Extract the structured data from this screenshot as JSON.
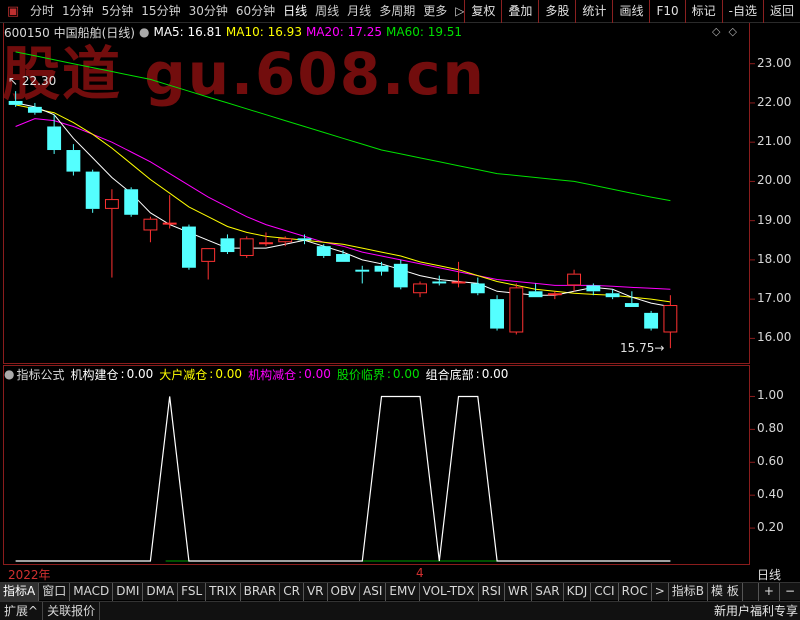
{
  "toolbar": {
    "icon": "menu-icon",
    "timeframes": [
      "分时",
      "1分钟",
      "5分钟",
      "15分钟",
      "30分钟",
      "60分钟",
      "日线",
      "周线",
      "月线",
      "多周期",
      "更多"
    ],
    "active": "日线",
    "more_arrow": "▷",
    "buttons": [
      "复权",
      "叠加",
      "多股",
      "统计",
      "画线",
      "F10",
      "标记",
      "-自选",
      "返回"
    ]
  },
  "stock": {
    "title": "600150 中国船舶(日线)"
  },
  "watermark": "股道 gu.608.cn",
  "ma": [
    {
      "label": "MA5: 16.81",
      "color": "#ffffff"
    },
    {
      "label": "MA10: 16.93",
      "color": "#ffff00"
    },
    {
      "label": "MA20: 17.25",
      "color": "#ff00ff"
    },
    {
      "label": "MA60: 19.51",
      "color": "#00e000"
    }
  ],
  "diamonds": "◇◇",
  "high_label": "22.30",
  "low_label": "15.75",
  "yaxis": [
    "23.00",
    "22.00",
    "21.00",
    "20.00",
    "19.00",
    "18.00",
    "17.00",
    "16.00"
  ],
  "chart_data": {
    "type": "candlestick",
    "ylim": [
      15.5,
      23.4
    ],
    "candles": [
      {
        "o": 22.05,
        "h": 22.3,
        "l": 21.9,
        "c": 21.95
      },
      {
        "o": 21.9,
        "h": 22.0,
        "l": 21.7,
        "c": 21.75
      },
      {
        "o": 21.4,
        "h": 21.7,
        "l": 20.7,
        "c": 20.8
      },
      {
        "o": 20.8,
        "h": 20.95,
        "l": 20.15,
        "c": 20.25
      },
      {
        "o": 20.25,
        "h": 20.3,
        "l": 19.2,
        "c": 19.3
      },
      {
        "o": 19.3,
        "h": 19.8,
        "l": 17.55,
        "c": 19.55
      },
      {
        "o": 19.8,
        "h": 19.85,
        "l": 19.1,
        "c": 19.15
      },
      {
        "o": 18.75,
        "h": 19.1,
        "l": 18.45,
        "c": 19.05
      },
      {
        "o": 18.95,
        "h": 19.65,
        "l": 18.8,
        "c": 18.95
      },
      {
        "o": 18.85,
        "h": 18.9,
        "l": 17.75,
        "c": 17.8
      },
      {
        "o": 17.95,
        "h": 18.3,
        "l": 17.5,
        "c": 18.3
      },
      {
        "o": 18.55,
        "h": 18.65,
        "l": 18.15,
        "c": 18.2
      },
      {
        "o": 18.1,
        "h": 18.6,
        "l": 18.05,
        "c": 18.55
      },
      {
        "o": 18.45,
        "h": 18.7,
        "l": 18.35,
        "c": 18.45
      },
      {
        "o": 18.45,
        "h": 18.6,
        "l": 18.35,
        "c": 18.55
      },
      {
        "o": 18.55,
        "h": 18.65,
        "l": 18.4,
        "c": 18.5
      },
      {
        "o": 18.35,
        "h": 18.4,
        "l": 18.05,
        "c": 18.1
      },
      {
        "o": 18.15,
        "h": 18.25,
        "l": 17.95,
        "c": 17.95
      },
      {
        "o": 17.75,
        "h": 17.85,
        "l": 17.4,
        "c": 17.7
      },
      {
        "o": 17.85,
        "h": 17.95,
        "l": 17.6,
        "c": 17.7
      },
      {
        "o": 17.9,
        "h": 18.0,
        "l": 17.25,
        "c": 17.3
      },
      {
        "o": 17.15,
        "h": 17.45,
        "l": 17.05,
        "c": 17.4
      },
      {
        "o": 17.45,
        "h": 17.6,
        "l": 17.35,
        "c": 17.4
      },
      {
        "o": 17.4,
        "h": 17.95,
        "l": 17.3,
        "c": 17.45
      },
      {
        "o": 17.4,
        "h": 17.55,
        "l": 17.1,
        "c": 17.15
      },
      {
        "o": 17.0,
        "h": 17.1,
        "l": 16.2,
        "c": 16.25
      },
      {
        "o": 16.15,
        "h": 17.4,
        "l": 16.1,
        "c": 17.3
      },
      {
        "o": 17.2,
        "h": 17.4,
        "l": 17.05,
        "c": 17.05
      },
      {
        "o": 17.1,
        "h": 17.2,
        "l": 17.0,
        "c": 17.15
      },
      {
        "o": 17.35,
        "h": 17.75,
        "l": 17.2,
        "c": 17.65
      },
      {
        "o": 17.35,
        "h": 17.4,
        "l": 17.1,
        "c": 17.2
      },
      {
        "o": 17.15,
        "h": 17.25,
        "l": 17.0,
        "c": 17.05
      },
      {
        "o": 16.9,
        "h": 17.2,
        "l": 16.8,
        "c": 16.8
      },
      {
        "o": 16.65,
        "h": 16.7,
        "l": 16.2,
        "c": 16.25
      },
      {
        "o": 16.15,
        "h": 17.1,
        "l": 15.75,
        "c": 16.85
      }
    ],
    "ma5": [
      22.0,
      21.9,
      21.7,
      21.1,
      20.6,
      20.1,
      19.7,
      19.2,
      18.9,
      18.7,
      18.5,
      18.3,
      18.3,
      18.3,
      18.4,
      18.5,
      18.35,
      18.2,
      18.0,
      17.9,
      17.75,
      17.6,
      17.5,
      17.45,
      17.4,
      17.2,
      17.15,
      17.1,
      17.1,
      17.2,
      17.3,
      17.25,
      17.05,
      16.9,
      16.81
    ],
    "ma10": [
      21.95,
      21.85,
      21.75,
      21.5,
      21.2,
      20.85,
      20.45,
      20.05,
      19.7,
      19.35,
      19.1,
      18.85,
      18.7,
      18.6,
      18.55,
      18.5,
      18.45,
      18.4,
      18.3,
      18.2,
      18.1,
      17.95,
      17.85,
      17.75,
      17.6,
      17.45,
      17.35,
      17.25,
      17.2,
      17.15,
      17.12,
      17.1,
      17.05,
      17.0,
      16.93
    ],
    "ma20": [
      21.4,
      21.6,
      21.55,
      21.4,
      21.2,
      21.0,
      20.75,
      20.5,
      20.2,
      19.9,
      19.6,
      19.35,
      19.1,
      18.9,
      18.75,
      18.6,
      18.45,
      18.35,
      18.2,
      18.1,
      18.0,
      17.9,
      17.8,
      17.7,
      17.6,
      17.5,
      17.45,
      17.4,
      17.35,
      17.35,
      17.35,
      17.33,
      17.3,
      17.28,
      17.25
    ],
    "ma60": [
      23.3,
      23.2,
      23.1,
      23.0,
      22.9,
      22.8,
      22.7,
      22.6,
      22.45,
      22.3,
      22.15,
      22.0,
      21.85,
      21.7,
      21.55,
      21.4,
      21.25,
      21.1,
      20.95,
      20.8,
      20.7,
      20.6,
      20.5,
      20.4,
      20.3,
      20.2,
      20.15,
      20.1,
      20.05,
      20.0,
      19.9,
      19.8,
      19.7,
      19.6,
      19.51
    ],
    "indicator": {
      "title": "指标公式",
      "ylim": [
        0,
        1.1
      ],
      "yaxis": [
        "1.00",
        "0.80",
        "0.60",
        "0.40",
        "0.20"
      ],
      "series": [
        {
          "name": "机构建仓",
          "value_label": "0.00",
          "color": "#ffffff",
          "values": [
            0,
            0,
            0,
            0,
            0,
            0,
            0,
            0,
            1,
            0,
            0,
            0,
            0,
            0,
            0,
            0,
            0,
            0,
            0,
            1,
            1,
            1,
            0,
            1,
            1,
            0,
            0,
            0,
            0,
            0,
            0,
            0,
            0,
            0,
            0
          ]
        },
        {
          "name": "大户减仓",
          "value_label": "0.00",
          "color": "#ffff00"
        },
        {
          "name": "机构减仓",
          "value_label": "0.00",
          "color": "#ff00ff"
        },
        {
          "name": "股价临界",
          "value_label": "0.00",
          "color": "#00e000"
        },
        {
          "name": "组合底部",
          "value_label": "0.00",
          "color": "#ffffff"
        }
      ]
    }
  },
  "dates": [
    {
      "label": "2022年",
      "index": 0
    },
    {
      "label": "4",
      "index": 21
    }
  ],
  "period_label": "日线",
  "tabs": [
    "指标A",
    "窗口",
    "MACD",
    "DMI",
    "DMA",
    "FSL",
    "TRIX",
    "BRAR",
    "CR",
    "VR",
    "OBV",
    "ASI",
    "EMV",
    "VOL-TDX",
    "RSI",
    "WR",
    "SAR",
    "KDJ",
    "CCI",
    "ROC",
    ">",
    "指标B",
    "模 板"
  ],
  "tab_tools": [
    "+",
    "−"
  ],
  "bottom": {
    "buttons": [
      "扩展^",
      "关联报价"
    ],
    "promo": "新用户福利专享"
  }
}
